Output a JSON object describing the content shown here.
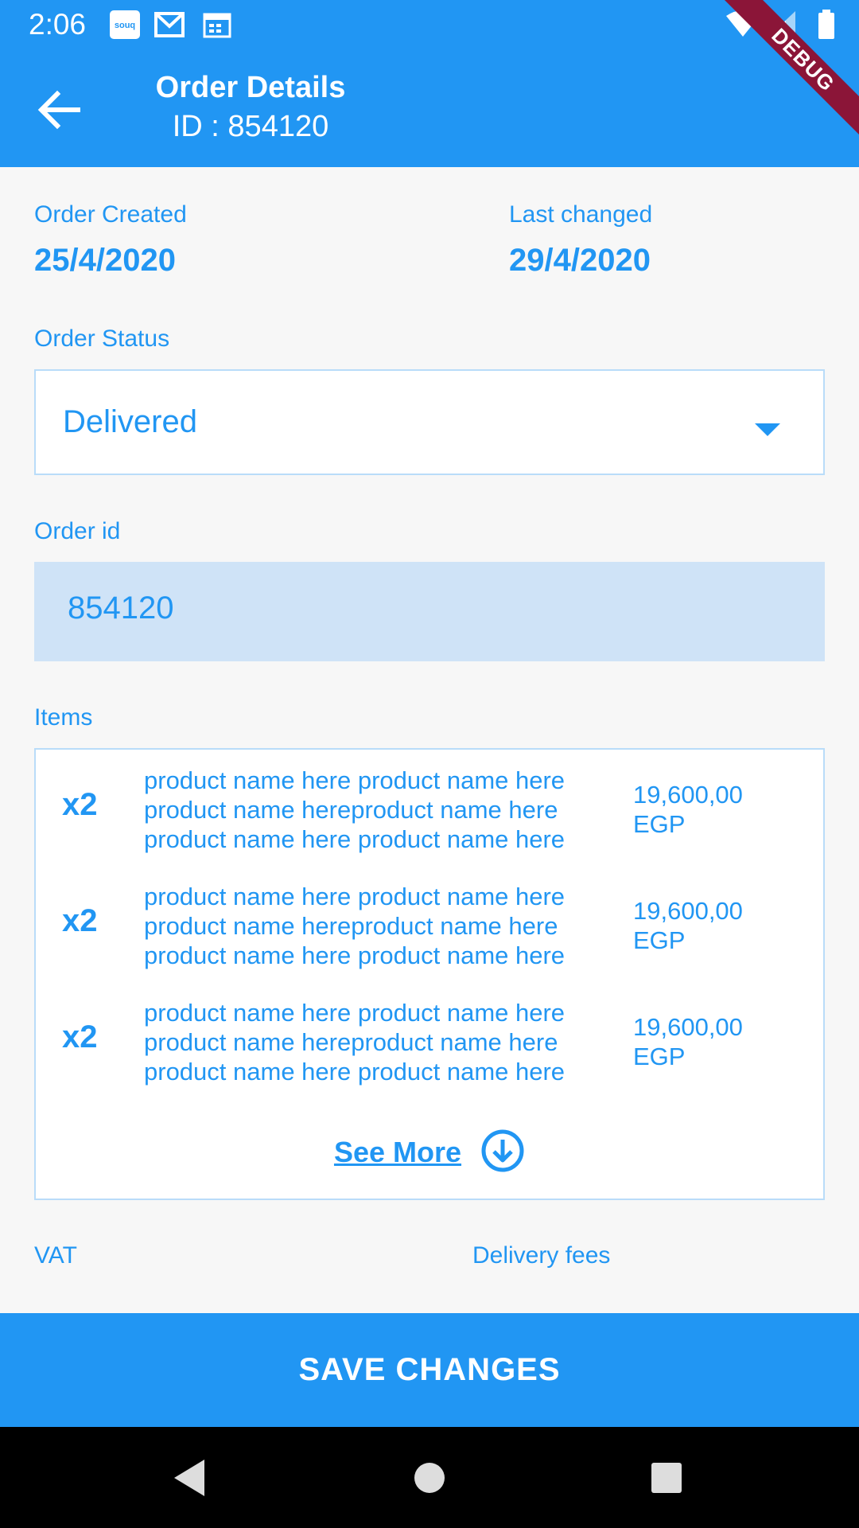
{
  "status_bar": {
    "time": "2:06",
    "notification_icons": [
      "souq-app-icon",
      "gmail-icon",
      "calendar-icon"
    ],
    "right_icons": [
      "wifi-icon",
      "signal-icon",
      "battery-icon"
    ]
  },
  "header": {
    "title": "Order Details",
    "subtitle": "ID : 854120",
    "debug_banner": "DEBUG"
  },
  "dates": {
    "created_label": "Order Created",
    "created_value": "25/4/2020",
    "changed_label": "Last changed",
    "changed_value": "29/4/2020"
  },
  "order_status": {
    "label": "Order Status",
    "selected": "Delivered"
  },
  "order_id": {
    "label": "Order id",
    "value": "854120"
  },
  "items": {
    "label": "Items",
    "rows": [
      {
        "qty": "x2",
        "name_lines": [
          "product name here product name here",
          "product name hereproduct name here",
          "product name here product name here"
        ],
        "price_lines": [
          "19,600,00",
          "EGP"
        ]
      },
      {
        "qty": "x2",
        "name_lines": [
          "product name here product name here",
          "product name hereproduct name here",
          "product name here product name here"
        ],
        "price_lines": [
          "19,600,00",
          "EGP"
        ]
      },
      {
        "qty": "x2",
        "name_lines": [
          "product name here product name here",
          "product name hereproduct name here",
          "product name here product name here"
        ],
        "price_lines": [
          "19,600,00",
          "EGP"
        ]
      }
    ],
    "see_more": "See More"
  },
  "fees": {
    "vat_label": "VAT",
    "delivery_label": "Delivery fees"
  },
  "actions": {
    "save_label": "SAVE CHANGES"
  },
  "colors": {
    "primary": "#2196f3",
    "field_fill": "#cfe3f7",
    "debug_ribbon": "#8b1538"
  }
}
